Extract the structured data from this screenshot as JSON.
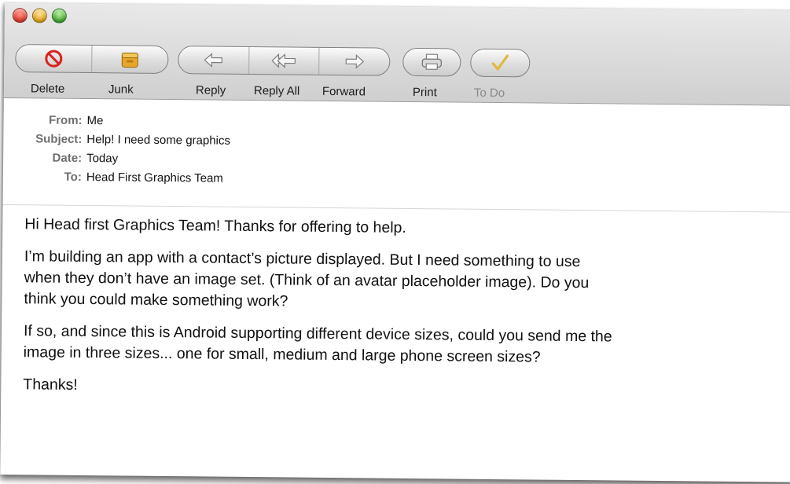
{
  "toolbar": {
    "delete_label": "Delete",
    "junk_label": "Junk",
    "reply_label": "Reply",
    "reply_all_label": "Reply All",
    "forward_label": "Forward",
    "print_label": "Print",
    "todo_label": "To Do"
  },
  "header": {
    "from_key": "From:",
    "from_value": "Me",
    "subject_key": "Subject:",
    "subject_value": "Help! I need some graphics",
    "date_key": "Date:",
    "date_value": "Today",
    "to_key": "To:",
    "to_value": "Head First Graphics Team"
  },
  "body": {
    "p1": "Hi Head first Graphics Team! Thanks for offering to help.",
    "p2_line1": "I’m building an app with a contact’s picture displayed. But I need something to use",
    "p2_line2": "when they don’t have an image set. (Think of an avatar placeholder image). Do you",
    "p2_line3": "think you could make something work?",
    "p3_line1": "If so, and since this is Android supporting different device sizes, could you send me the",
    "p3_line2": "image in three sizes... one for small, medium and large phone screen sizes?",
    "p4": "Thanks!"
  },
  "colors": {
    "toolbar_top": "#e9e9e9",
    "toolbar_bottom": "#cfcfcf",
    "delete_red": "#d8231c",
    "todo_gold": "#e2b93b"
  },
  "icons": {
    "delete": "no-entry-icon",
    "junk": "junk-bin-icon",
    "reply": "reply-arrow-icon",
    "reply_all": "reply-all-arrow-icon",
    "forward": "forward-arrow-icon",
    "print": "printer-icon",
    "todo": "checkmark-icon"
  }
}
